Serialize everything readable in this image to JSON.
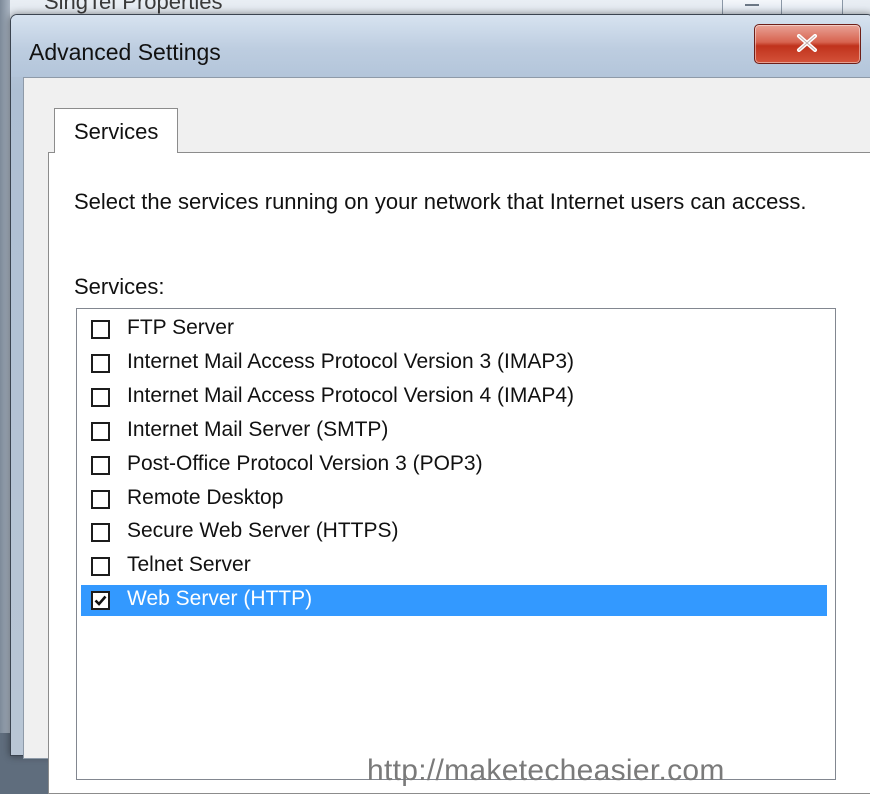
{
  "background_window": {
    "title": "SingTel Properties"
  },
  "dialog": {
    "title": "Advanced Settings",
    "close_icon": "close-x-icon"
  },
  "tabs": [
    {
      "label": "Services",
      "active": true
    }
  ],
  "panel": {
    "description": "Select the services running on your network that Internet users can access.",
    "services_label": "Services:",
    "services": [
      {
        "label": "FTP Server",
        "checked": false,
        "selected": false
      },
      {
        "label": "Internet Mail Access Protocol Version 3 (IMAP3)",
        "checked": false,
        "selected": false
      },
      {
        "label": "Internet Mail Access Protocol Version 4 (IMAP4)",
        "checked": false,
        "selected": false
      },
      {
        "label": "Internet Mail Server (SMTP)",
        "checked": false,
        "selected": false
      },
      {
        "label": "Post-Office Protocol Version 3 (POP3)",
        "checked": false,
        "selected": false
      },
      {
        "label": "Remote Desktop",
        "checked": false,
        "selected": false
      },
      {
        "label": "Secure Web Server (HTTPS)",
        "checked": false,
        "selected": false
      },
      {
        "label": "Telnet Server",
        "checked": false,
        "selected": false
      },
      {
        "label": "Web Server (HTTP)",
        "checked": true,
        "selected": true
      }
    ]
  },
  "watermark": "http://maketecheasier.com",
  "colors": {
    "selection": "#3399ff",
    "close_button": "#c0321c"
  }
}
